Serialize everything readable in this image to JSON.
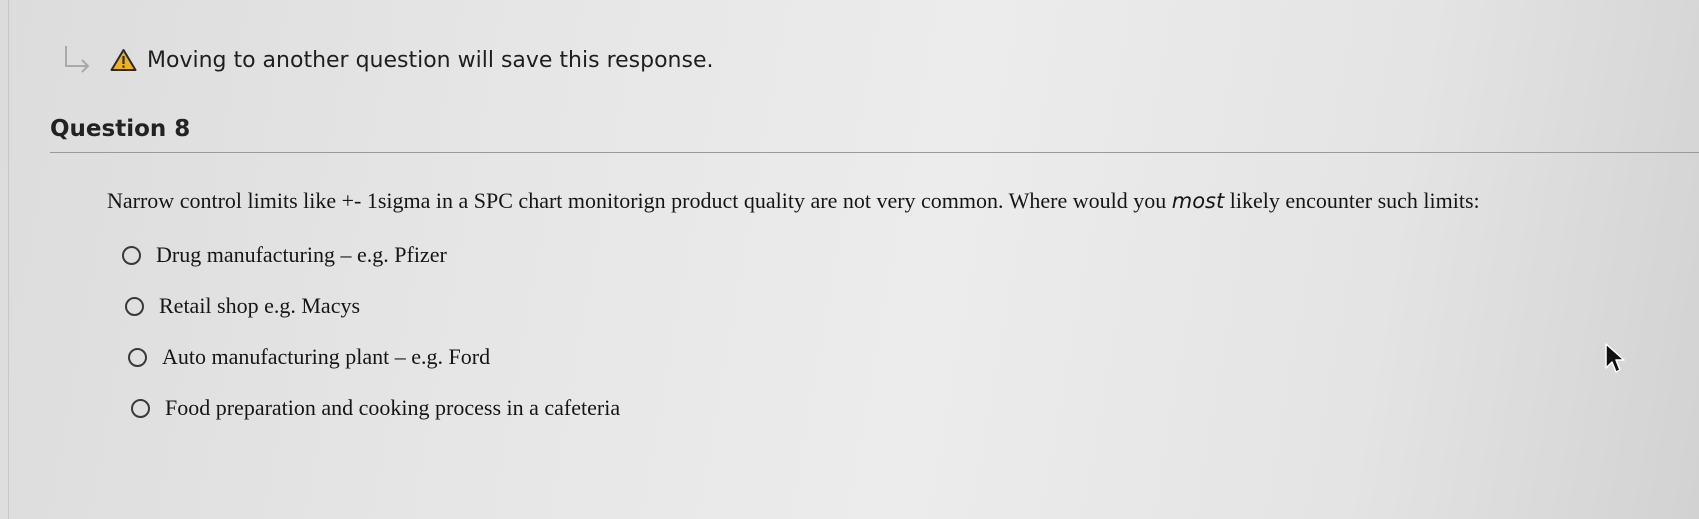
{
  "notice": {
    "text": "Moving to another question will save this response.",
    "icons": [
      "return-arrow-icon",
      "warning-icon"
    ],
    "warning_color": "#e8a400"
  },
  "question": {
    "title": "Question 8",
    "prompt_before": "Narrow control limits like +- 1sigma in a SPC chart monitorign product quality are not very common. Where would you ",
    "prompt_emphasis": "most",
    "prompt_after": " likely encounter such limits:",
    "options": [
      {
        "label": "Drug manufacturing – e.g. Pfizer",
        "selected": false
      },
      {
        "label": "Retail shop e.g. Macys",
        "selected": false
      },
      {
        "label": "Auto manufacturing plant – e.g. Ford",
        "selected": false
      },
      {
        "label": "Food preparation and cooking process in a cafeteria",
        "selected": false
      }
    ]
  }
}
